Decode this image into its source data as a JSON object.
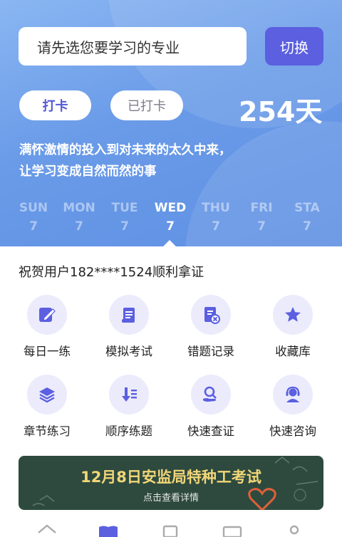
{
  "header": {
    "search_placeholder": "请先选您要学习的专业",
    "switch_label": "切换"
  },
  "checkin": {
    "checkin_label": "打卡",
    "checked_label": "已打卡",
    "days": "254天"
  },
  "slogan": {
    "line1": "满怀激情的投入到对未来的太久中来，",
    "line2": "让学习变成自然而然的事"
  },
  "week": [
    {
      "name": "SUN",
      "value": "7"
    },
    {
      "name": "MON",
      "value": "7"
    },
    {
      "name": "TUE",
      "value": "7"
    },
    {
      "name": "WED",
      "value": "7"
    },
    {
      "name": "THU",
      "value": "7"
    },
    {
      "name": "FRI",
      "value": "7"
    },
    {
      "name": "STA",
      "value": "7"
    }
  ],
  "congrats": "祝贺用户182****1524顺利拿证",
  "features": [
    {
      "label": "每日一练",
      "icon": "edit-icon"
    },
    {
      "label": "模拟考试",
      "icon": "scroll-icon"
    },
    {
      "label": "错题记录",
      "icon": "error-doc-icon"
    },
    {
      "label": "收藏库",
      "icon": "star-icon"
    },
    {
      "label": "章节练习",
      "icon": "layers-icon"
    },
    {
      "label": "顺序练题",
      "icon": "sort-list-icon"
    },
    {
      "label": "快速查证",
      "icon": "search-hand-icon"
    },
    {
      "label": "快速咨询",
      "icon": "headset-icon"
    }
  ],
  "banner": {
    "title": "12月8日安监局特种工考试",
    "subtitle": "点击查看详情"
  },
  "colors": {
    "accent": "#5b5fe0",
    "hero": "#6a9be8",
    "icon_bg": "#ebebfc"
  }
}
